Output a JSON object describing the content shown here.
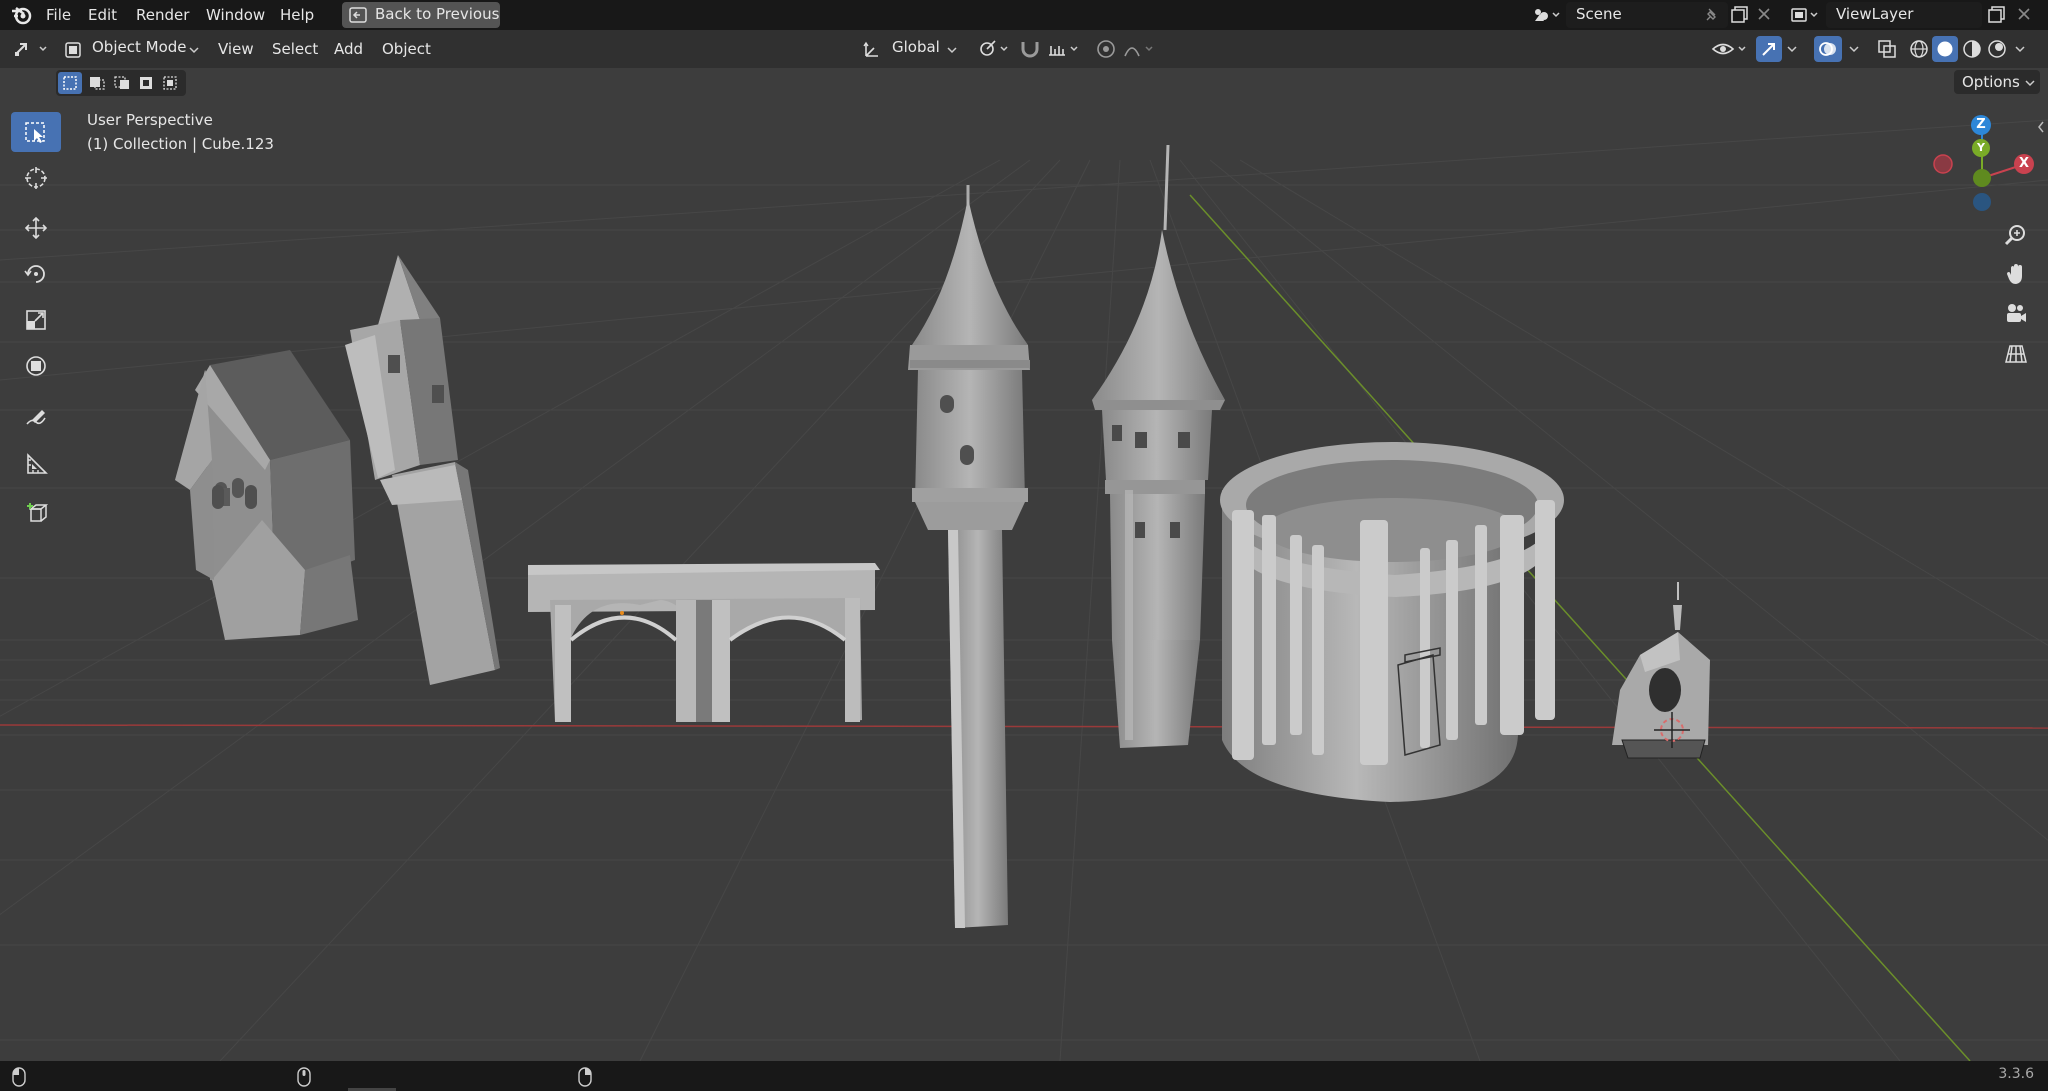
{
  "top_menu": {
    "items": [
      "File",
      "Edit",
      "Render",
      "Window",
      "Help"
    ],
    "back_button": "Back to Previous",
    "scene_name": "Scene",
    "view_layer": "ViewLayer"
  },
  "header": {
    "mode": "Object Mode",
    "menus": [
      "View",
      "Select",
      "Add",
      "Object"
    ],
    "transform_orientation": "Global",
    "options_label": "Options"
  },
  "viewport": {
    "perspective_label": "User Perspective",
    "collection_label": "(1) Collection | Cube.123"
  },
  "gizmo": {
    "x": "X",
    "y": "Y",
    "z": "Z",
    "colors": {
      "x": "#c9424f",
      "y": "#7aab27",
      "z": "#2d87d8"
    }
  },
  "status": {
    "version": "3.3.6"
  },
  "theme": {
    "accent": "#4772b3",
    "viewport_bg": "#3d3d3d",
    "header_bg": "#303030",
    "topbar_bg": "#181818"
  }
}
